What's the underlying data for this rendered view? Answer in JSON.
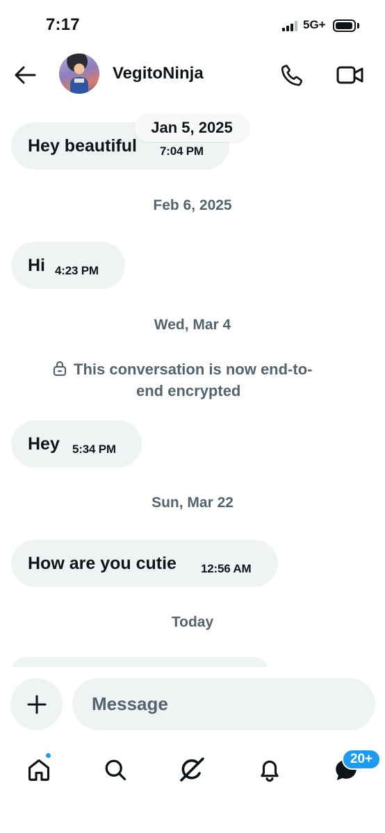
{
  "status_bar": {
    "time": "7:17",
    "network": "5G+",
    "signal_bars": 3,
    "battery_level": 0.95
  },
  "header": {
    "contact_name": "VegitoNinja",
    "back_icon": "arrow-left-icon",
    "call_icon": "phone-icon",
    "video_icon": "video-camera-icon"
  },
  "messages": [
    {
      "text": "Hey beautiful",
      "time": "7:04 PM"
    },
    {
      "text": "Hi",
      "time": "4:23 PM"
    },
    {
      "text": "Hey",
      "time": "5:34 PM"
    },
    {
      "text": "How are you cutie",
      "time": "12:56 AM"
    }
  ],
  "floating_date": "Jan 5, 2025",
  "date_separators": [
    "Feb 6, 2025",
    "Wed, Mar 4",
    "Sun, Mar 22",
    "Today"
  ],
  "encryption_note": {
    "line1": "This conversation is now end-to-",
    "line2": "end encrypted",
    "icon": "lock-icon"
  },
  "composer": {
    "placeholder": "Message",
    "add_icon": "plus-icon"
  },
  "bottom_nav": {
    "items": [
      "home-icon",
      "search-icon",
      "grok-icon",
      "bell-icon",
      "messages-icon"
    ],
    "messages_badge": "20+"
  },
  "colors": {
    "accent": "#1d9bf0",
    "bubble": "#eff3f4",
    "secondary_text": "#536471",
    "primary_text": "#0f1419"
  }
}
